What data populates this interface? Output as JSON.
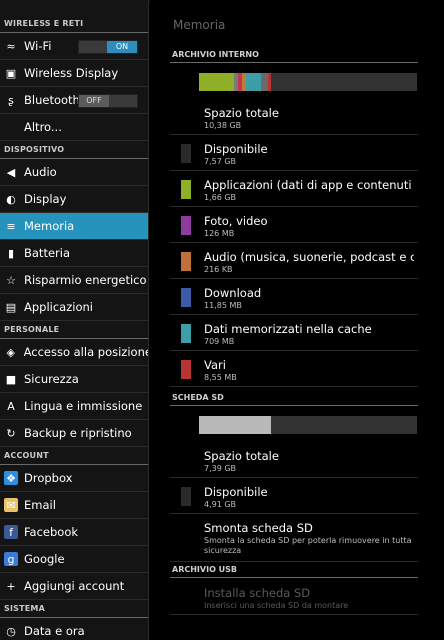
{
  "sidebar": {
    "sections": [
      {
        "label": "WIRELESS E RETI",
        "items": [
          {
            "label": "Wi-Fi",
            "icon": "wifi-icon",
            "glyph": "≈",
            "toggle": {
              "state": "on",
              "label": "ON"
            }
          },
          {
            "label": "Wireless Display",
            "icon": "wireless-display-icon",
            "glyph": "▣"
          },
          {
            "label": "Bluetooth",
            "icon": "bluetooth-icon",
            "glyph": "ʂ",
            "toggle": {
              "state": "off",
              "label": "OFF"
            }
          },
          {
            "label": "Altro...",
            "icon": "",
            "glyph": ""
          }
        ]
      },
      {
        "label": "DISPOSITIVO",
        "items": [
          {
            "label": "Audio",
            "icon": "speaker-icon",
            "glyph": "◀"
          },
          {
            "label": "Display",
            "icon": "display-brightness-icon",
            "glyph": "◐"
          },
          {
            "label": "Memoria",
            "icon": "storage-icon",
            "glyph": "≡",
            "selected": true
          },
          {
            "label": "Batteria",
            "icon": "battery-icon",
            "glyph": "▮"
          },
          {
            "label": "Risparmio energetico",
            "icon": "power-saving-icon",
            "glyph": "☆"
          },
          {
            "label": "Applicazioni",
            "icon": "apps-icon",
            "glyph": "▤"
          }
        ]
      },
      {
        "label": "PERSONALE",
        "items": [
          {
            "label": "Accesso alla posizione",
            "icon": "location-icon",
            "glyph": "◈"
          },
          {
            "label": "Sicurezza",
            "icon": "lock-icon",
            "glyph": "■"
          },
          {
            "label": "Lingua e immissione",
            "icon": "keyboard-language-icon",
            "glyph": "A"
          },
          {
            "label": "Backup e ripristino",
            "icon": "backup-icon",
            "glyph": "↻"
          }
        ]
      },
      {
        "label": "ACCOUNT",
        "items": [
          {
            "label": "Dropbox",
            "icon": "dropbox-icon",
            "glyph": "❖",
            "color": "#2d8fe0"
          },
          {
            "label": "Email",
            "icon": "email-icon",
            "glyph": "✉",
            "color": "#e8c26b"
          },
          {
            "label": "Facebook",
            "icon": "facebook-icon",
            "glyph": "f",
            "color": "#3b5998"
          },
          {
            "label": "Google",
            "icon": "google-icon",
            "glyph": "g",
            "color": "#3d7bd7"
          },
          {
            "label": "Aggiungi account",
            "icon": "add-icon",
            "glyph": "+"
          }
        ]
      },
      {
        "label": "SISTEMA",
        "items": [
          {
            "label": "Data e ora",
            "icon": "clock-icon",
            "glyph": "◷"
          }
        ]
      }
    ]
  },
  "main": {
    "title": "Memoria",
    "internal": {
      "header": "ARCHIVIO INTERNO",
      "bar_segments": [
        {
          "color": "#8fb026",
          "fraction": 0.16
        },
        {
          "color": "#7a7a7a",
          "fraction": 0.02
        },
        {
          "color": "#c0394b",
          "fraction": 0.015
        },
        {
          "color": "#c07a3a",
          "fraction": 0.02
        },
        {
          "color": "#3e9ea8",
          "fraction": 0.07
        },
        {
          "color": "#6a6a6a",
          "fraction": 0.03
        },
        {
          "color": "#b83434",
          "fraction": 0.015
        }
      ],
      "rows": [
        {
          "title": "Spazio totale",
          "value": "10,38 GB",
          "color": ""
        },
        {
          "title": "Disponibile",
          "value": "7,57 GB",
          "color": "#2a2a2a"
        },
        {
          "title": "Applicazioni (dati di app e contenuti multi",
          "value": "1,66 GB",
          "color": "#8fb026"
        },
        {
          "title": "Foto, video",
          "value": "126 MB",
          "color": "#8e3b9e"
        },
        {
          "title": "Audio (musica, suonerie, podcast e così v",
          "value": "216 KB",
          "color": "#c0703a"
        },
        {
          "title": "Download",
          "value": "11,85 MB",
          "color": "#3b5aa8"
        },
        {
          "title": "Dati memorizzati nella cache",
          "value": "709 MB",
          "color": "#3e9ea8"
        },
        {
          "title": "Vari",
          "value": "8,55 MB",
          "color": "#b83434"
        }
      ]
    },
    "sd": {
      "header": "SCHEDA SD",
      "bar_used_fraction": 0.33,
      "rows": [
        {
          "title": "Spazio totale",
          "value": "7,39 GB",
          "color": ""
        },
        {
          "title": "Disponibile",
          "value": "4,91 GB",
          "color": "#2a2a2a"
        },
        {
          "title": "Smonta scheda SD",
          "value": "Smonta la scheda SD per poterla rimuovere in tutta sicurezza",
          "color": ""
        }
      ]
    },
    "usb": {
      "header": "ARCHIVIO USB",
      "rows": [
        {
          "title": "Installa scheda SD",
          "value": "Inserisci una scheda SD da montare",
          "color": "",
          "disabled": true
        }
      ]
    }
  }
}
